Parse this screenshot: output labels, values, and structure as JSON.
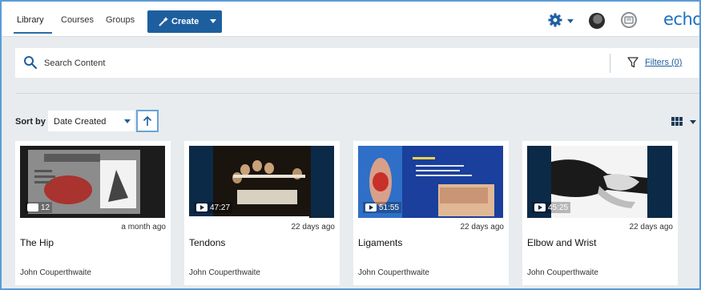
{
  "nav": {
    "tabs": [
      {
        "label": "Library"
      },
      {
        "label": "Courses"
      },
      {
        "label": "Groups"
      }
    ],
    "create_label": "Create",
    "logo_text": "echo"
  },
  "search": {
    "placeholder": "Search Content",
    "filters_label": "Filters (0)"
  },
  "sort": {
    "label": "Sort by",
    "value": "Date Created"
  },
  "cards": [
    {
      "badge": "12",
      "badge_type": "slides",
      "date": "a month ago",
      "title": "The Hip",
      "owner": "John Couperthwaite"
    },
    {
      "badge": "47:27",
      "badge_type": "video",
      "date": "22 days ago",
      "title": "Tendons",
      "owner": "John Couperthwaite"
    },
    {
      "badge": "51:55",
      "badge_type": "video",
      "date": "22 days ago",
      "title": "Ligaments",
      "owner": "John Couperthwaite"
    },
    {
      "badge": "45:25",
      "badge_type": "video",
      "date": "22 days ago",
      "title": "Elbow and Wrist",
      "owner": "John Couperthwaite"
    }
  ],
  "colors": {
    "accent": "#1d5f9e",
    "logo": "#1d6fc0",
    "background": "#e8ecef"
  }
}
